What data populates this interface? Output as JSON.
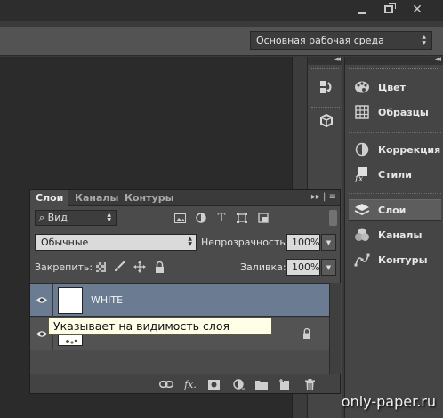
{
  "workspace": {
    "selected": "Основная рабочая среда"
  },
  "dock_right": {
    "items": [
      {
        "label": "Цвет",
        "icon": "color-palette-icon"
      },
      {
        "label": "Образцы",
        "icon": "swatches-grid-icon"
      },
      {
        "label": "Коррекция",
        "icon": "adjustments-icon"
      },
      {
        "label": "Стили",
        "icon": "styles-fx-icon"
      },
      {
        "label": "Слои",
        "icon": "layers-icon",
        "active": true
      },
      {
        "label": "Каналы",
        "icon": "channels-icon"
      },
      {
        "label": "Контуры",
        "icon": "paths-icon"
      }
    ]
  },
  "layers_panel": {
    "tabs": [
      "Слои",
      "Каналы",
      "Контуры"
    ],
    "filter_kind": "Вид",
    "blend_mode": "Обычные",
    "opacity_label": "Непрозрачность:",
    "opacity_value": "100%",
    "lock_label": "Закрепить:",
    "fill_label": "Заливка:",
    "fill_value": "100%",
    "layers": [
      {
        "name": "WHITE",
        "selected": true,
        "visible": true
      },
      {
        "name": "",
        "selected": false,
        "visible": true,
        "locked": true
      }
    ],
    "tooltip": "Указывает на видимость слоя"
  },
  "watermark": "only-paper.ru"
}
